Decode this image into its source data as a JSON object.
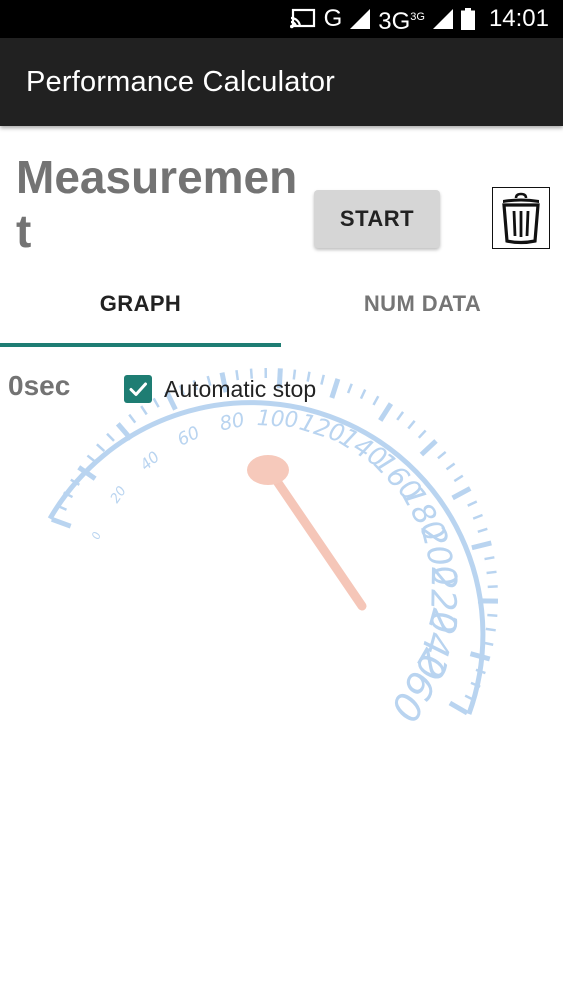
{
  "status_bar": {
    "network_g": "G",
    "network_3g": "3G",
    "network_3g_sup": "3G",
    "time": "14:01"
  },
  "app_bar": {
    "title": "Performance Calculator"
  },
  "header": {
    "title": "Measurement",
    "start_label": "START",
    "delete_icon": "trash-icon"
  },
  "tabs": [
    {
      "label": "GRAPH",
      "selected": true
    },
    {
      "label": "NUM DATA",
      "selected": false
    }
  ],
  "graph": {
    "elapsed": "0sec",
    "auto_stop_label": "Automatic stop",
    "auto_stop_checked": true,
    "gauge_labels": [
      "0",
      "20",
      "40",
      "60",
      "80",
      "100",
      "120",
      "140",
      "160",
      "180",
      "200",
      "220",
      "240",
      "260"
    ]
  },
  "colors": {
    "accent": "#1e7d73",
    "app_bar": "#212121",
    "gauge": "#b9d4f0",
    "needle": "#f5c6b8"
  }
}
